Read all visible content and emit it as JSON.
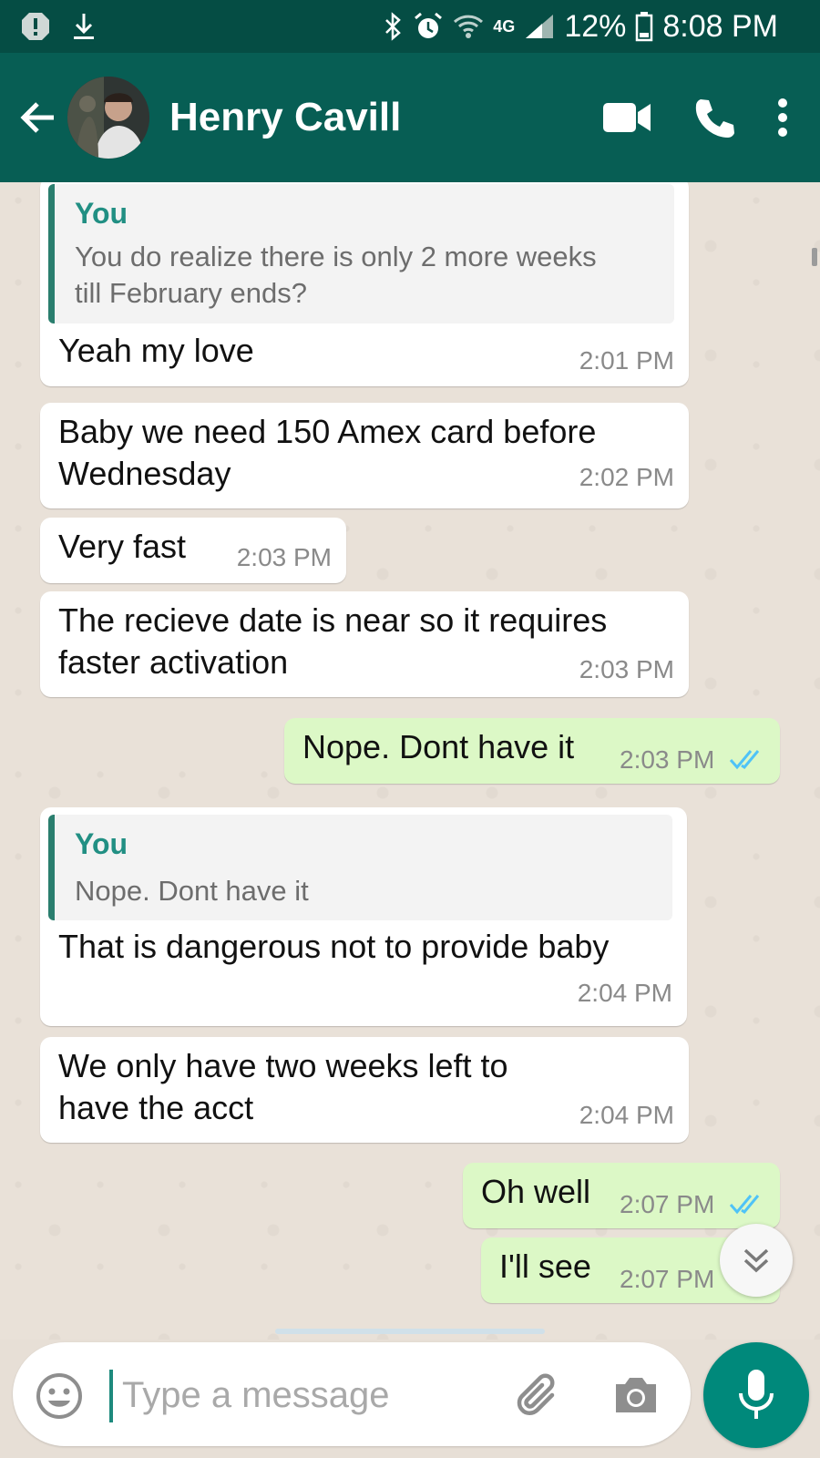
{
  "status_bar": {
    "network": "4G",
    "battery": "12%",
    "time": "8:08 PM",
    "icons": [
      "alert-icon",
      "download-icon",
      "bluetooth-icon",
      "alarm-icon",
      "wifi-icon",
      "signal-icon",
      "battery-icon"
    ]
  },
  "header": {
    "contact_name": "Henry Cavill",
    "icons": [
      "back-arrow-icon",
      "video-call-icon",
      "phone-icon",
      "more-vert-icon"
    ]
  },
  "messages": [
    {
      "direction": "in",
      "quote": {
        "author": "You",
        "text_lines": [
          "You do realize there is only 2 more weeks",
          "till February ends?"
        ]
      },
      "text_lines": [
        "Yeah my love"
      ],
      "time": "2:01 PM"
    },
    {
      "direction": "in",
      "text_lines": [
        "Baby we need 150 Amex card before",
        "Wednesday"
      ],
      "time": "2:02 PM"
    },
    {
      "direction": "in",
      "text_lines": [
        "Very fast"
      ],
      "time": "2:03 PM"
    },
    {
      "direction": "in",
      "text_lines": [
        "The recieve date is near so it requires",
        "faster activation"
      ],
      "time": "2:03 PM"
    },
    {
      "direction": "out",
      "text_lines": [
        "Nope. Dont have it"
      ],
      "time": "2:03 PM",
      "status": "read"
    },
    {
      "direction": "in",
      "quote": {
        "author": "You",
        "text_lines": [
          "Nope. Dont have it"
        ]
      },
      "text_lines": [
        "That is dangerous not to provide baby"
      ],
      "time": "2:04 PM"
    },
    {
      "direction": "in",
      "text_lines": [
        "We only have two weeks left to",
        "have the acct"
      ],
      "time": "2:04 PM"
    },
    {
      "direction": "out",
      "text_lines": [
        "Oh well"
      ],
      "time": "2:07 PM",
      "status": "read"
    },
    {
      "direction": "out",
      "text_lines": [
        "I'll see"
      ],
      "time": "2:07 PM",
      "status": "read"
    }
  ],
  "composer": {
    "placeholder": "Type a message",
    "icons": [
      "emoji-icon",
      "attach-icon",
      "camera-icon",
      "mic-icon",
      "scroll-down-icon"
    ]
  },
  "colors": {
    "status_bar": "#054d44",
    "app_bar": "#075e54",
    "outgoing_bubble": "#dcf8c6",
    "incoming_bubble": "#ffffff",
    "read_ticks": "#4fc3f7",
    "accent": "#00897b"
  }
}
